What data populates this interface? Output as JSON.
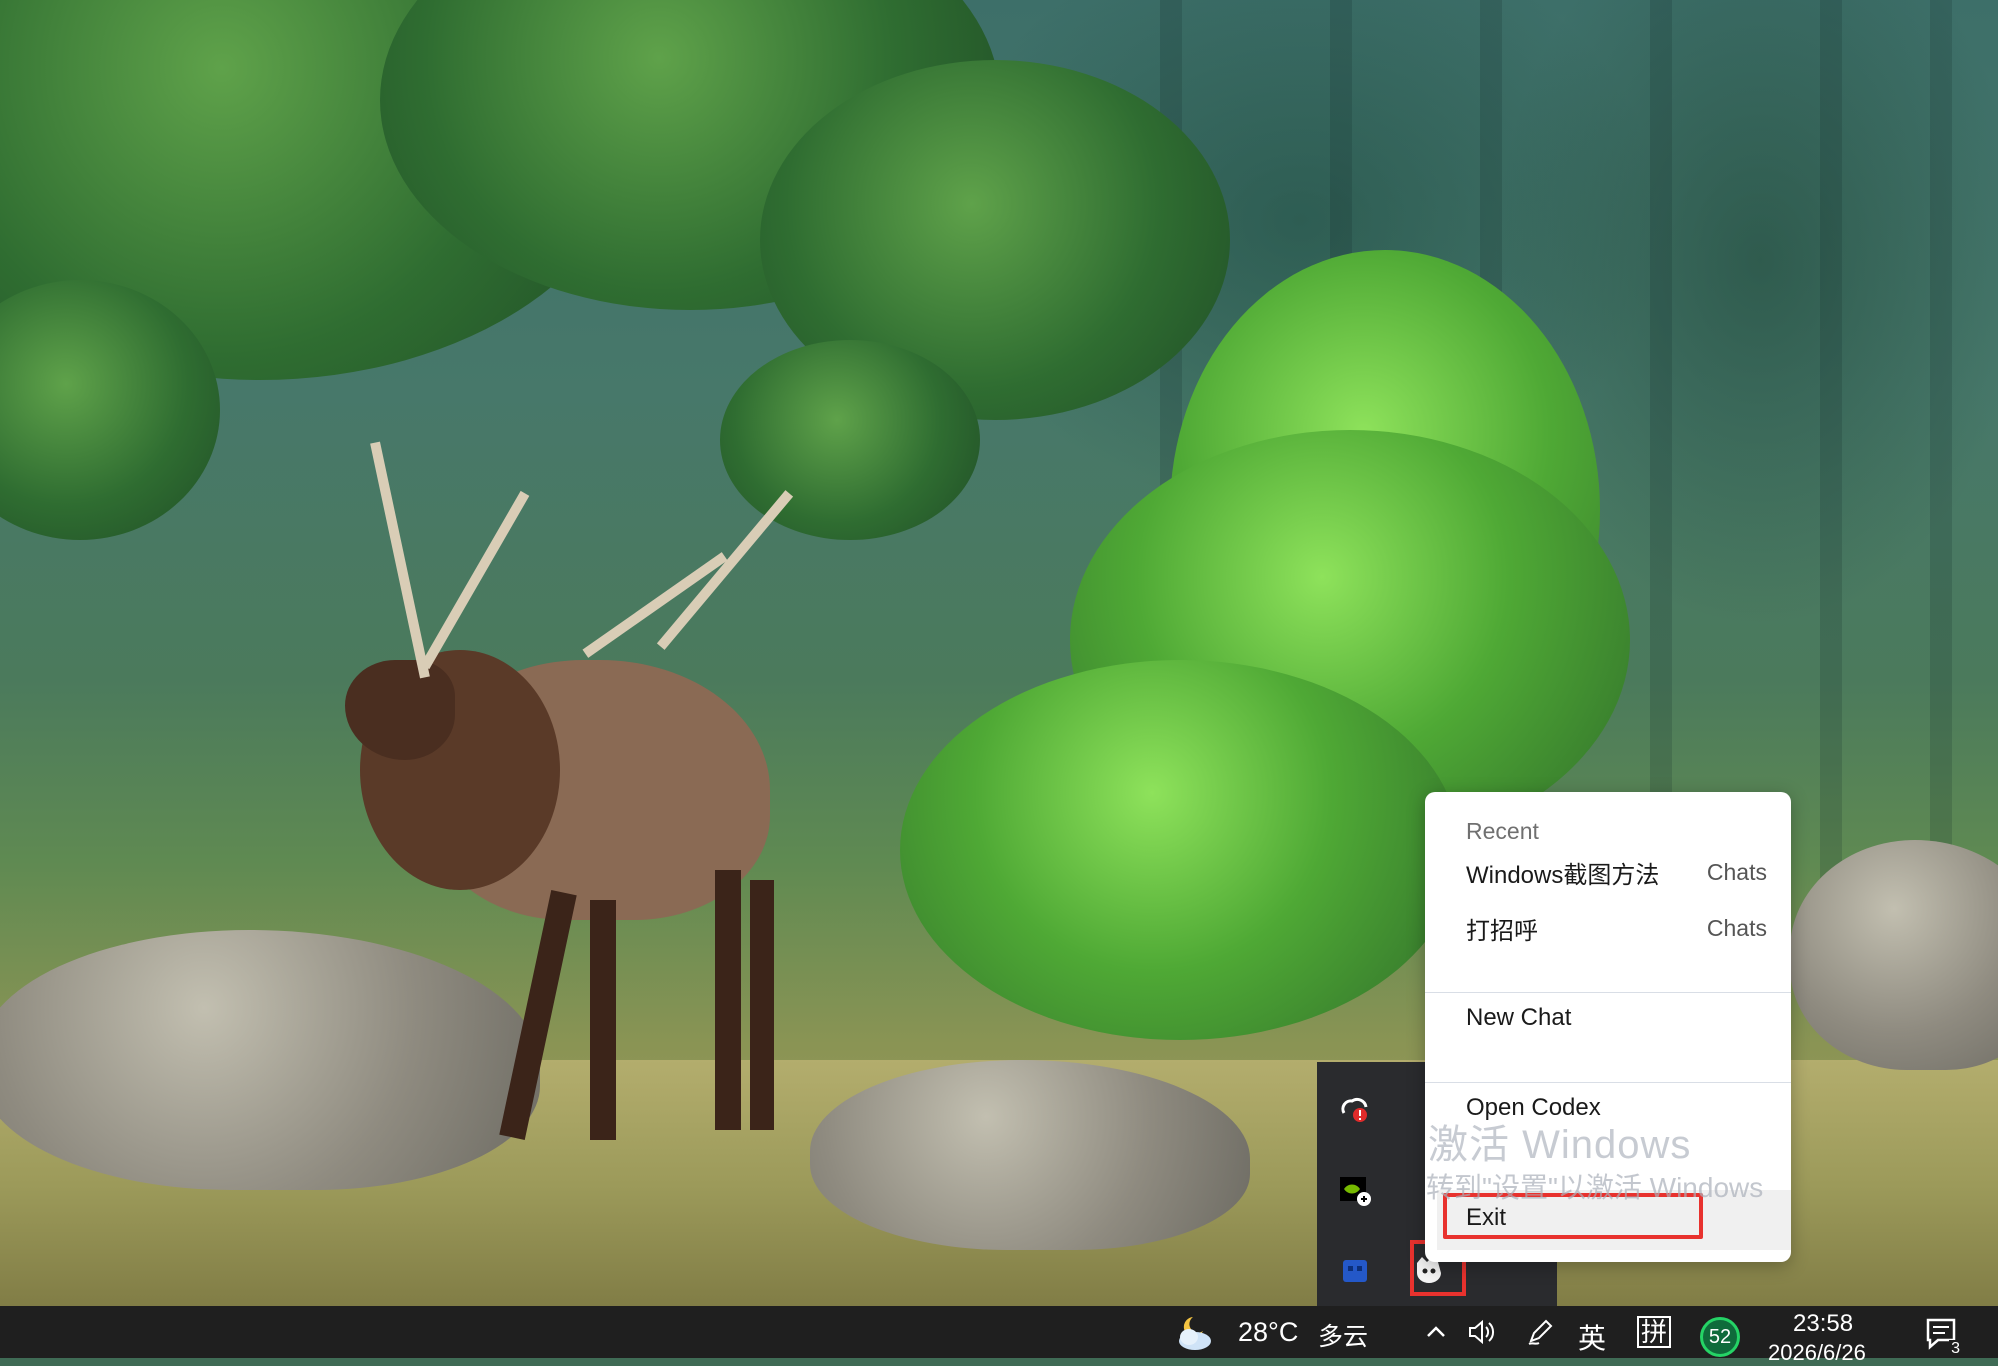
{
  "context_menu": {
    "section_label": "Recent",
    "recent_items": [
      {
        "label": "Windows截图方法",
        "meta": "Chats"
      },
      {
        "label": "打招呼",
        "meta": "Chats"
      }
    ],
    "new_chat_label": "New Chat",
    "open_codex_label": "Open Codex",
    "exit_label": "Exit"
  },
  "watermark": {
    "title": "激活 Windows",
    "subtitle": "转到\"设置\"以激活 Windows"
  },
  "taskbar": {
    "weather_temp": "28°C",
    "weather_desc": "多云",
    "ime_lang": "英",
    "ime_mode": "拼",
    "badge_count": "52",
    "time": "23:58",
    "date": "2026/6/26",
    "notification_count": "3"
  },
  "colors": {
    "highlight_red": "#e8322e",
    "taskbar_bg": "#1f1f1f",
    "flyout_bg": "#2a2b2e"
  }
}
